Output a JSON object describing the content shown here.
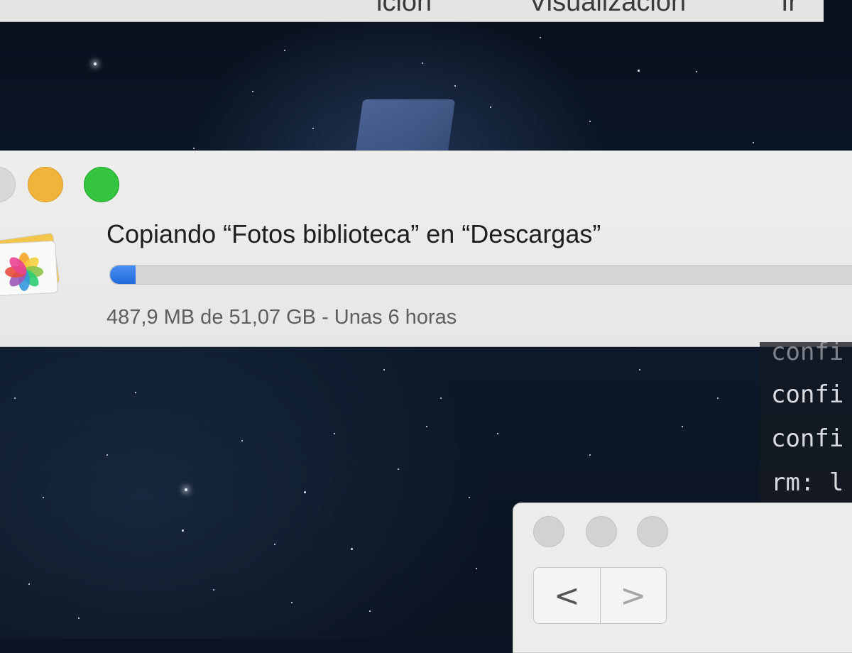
{
  "menubar": {
    "items": [
      "ición",
      "Visualización",
      "Ir"
    ]
  },
  "copy_dialog": {
    "title": "Copiando “Fotos biblioteca” en “Descargas”",
    "status": "487,9 MB de 51,07 GB - Unas 6 horas",
    "progress_fraction": 0.0095,
    "icon": "photos-app-icon",
    "colors": {
      "progress": "#1f6ad8",
      "minimize": "#f2b33c",
      "zoom": "#35c43f"
    }
  },
  "terminal": {
    "lines": [
      "confi",
      "confi",
      "confi",
      "rm: l"
    ]
  },
  "finder": {
    "back_glyph": "<",
    "forward_glyph": ">"
  }
}
